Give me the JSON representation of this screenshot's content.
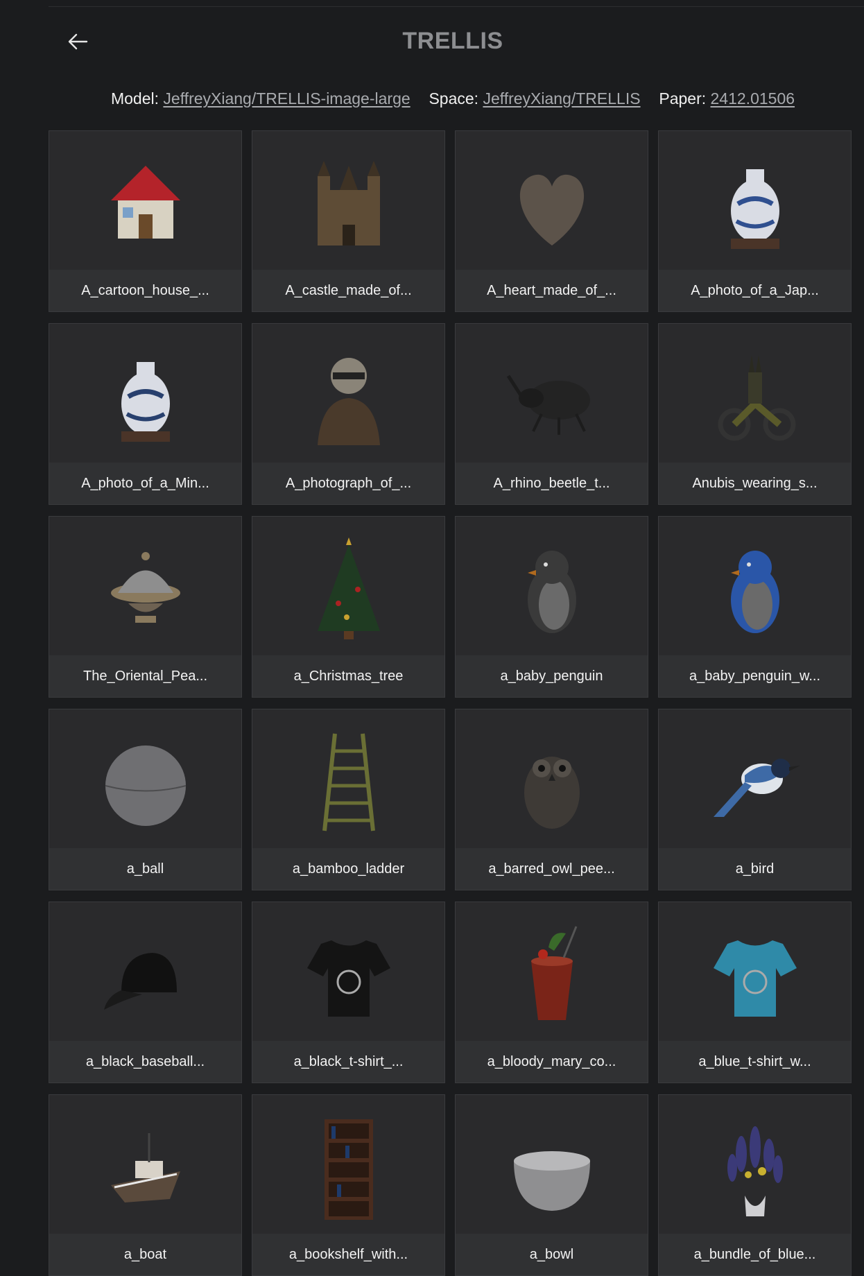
{
  "header": {
    "title": "TRELLIS",
    "model_label": "Model:",
    "model_link": "JeffreyXiang/TRELLIS-image-large",
    "space_label": "Space:",
    "space_link": "JeffreyXiang/TRELLIS",
    "paper_label": "Paper:",
    "paper_link": "2412.01506"
  },
  "gallery": {
    "items": [
      {
        "label": "A_cartoon_house_...",
        "icon": "house-icon",
        "color": "#b4232a"
      },
      {
        "label": "A_castle_made_of...",
        "icon": "castle-icon",
        "color": "#5e4c36"
      },
      {
        "label": "A_heart_made_of_...",
        "icon": "heart-icon",
        "color": "#5c534a"
      },
      {
        "label": "A_photo_of_a_Jap...",
        "icon": "vase-icon",
        "color": "#2f4f8f"
      },
      {
        "label": "A_photo_of_a_Min...",
        "icon": "vase-icon",
        "color": "#28406e"
      },
      {
        "label": "A_photograph_of_...",
        "icon": "bust-icon",
        "color": "#4a3a2b"
      },
      {
        "label": "A_rhino_beetle_t...",
        "icon": "beetle-icon",
        "color": "#232323"
      },
      {
        "label": "Anubis_wearing_s...",
        "icon": "motorcycle-icon",
        "color": "#5a5a2a"
      },
      {
        "label": "The_Oriental_Pea...",
        "icon": "dome-icon",
        "color": "#8a7a5e"
      },
      {
        "label": "a_Christmas_tree",
        "icon": "tree-icon",
        "color": "#1f3b22"
      },
      {
        "label": "a_baby_penguin",
        "icon": "penguin-icon",
        "color": "#3a3a3a"
      },
      {
        "label": "a_baby_penguin_w...",
        "icon": "penguin-icon",
        "color": "#2a56a8"
      },
      {
        "label": "a_ball",
        "icon": "ball-icon",
        "color": "#6f6f72"
      },
      {
        "label": "a_bamboo_ladder",
        "icon": "ladder-icon",
        "color": "#6a6f35"
      },
      {
        "label": "a_barred_owl_pee...",
        "icon": "owl-icon",
        "color": "#3e3a36"
      },
      {
        "label": "a_bird",
        "icon": "bird-icon",
        "color": "#3e6aa6"
      },
      {
        "label": "a_black_baseball...",
        "icon": "cap-icon",
        "color": "#111111"
      },
      {
        "label": "a_black_t-shirt_...",
        "icon": "tshirt-icon",
        "color": "#141414"
      },
      {
        "label": "a_bloody_mary_co...",
        "icon": "glass-icon",
        "color": "#7a2418"
      },
      {
        "label": "a_blue_t-shirt_w...",
        "icon": "tshirt-icon",
        "color": "#2f8aa8"
      },
      {
        "label": "a_boat",
        "icon": "boat-icon",
        "color": "#5a4a3c"
      },
      {
        "label": "a_bookshelf_with...",
        "icon": "bookshelf-icon",
        "color": "#4a2c1e"
      },
      {
        "label": "a_bowl",
        "icon": "bowl-icon",
        "color": "#8f8f91"
      },
      {
        "label": "a_bundle_of_blue...",
        "icon": "flowers-icon",
        "color": "#3b3a78"
      }
    ]
  }
}
